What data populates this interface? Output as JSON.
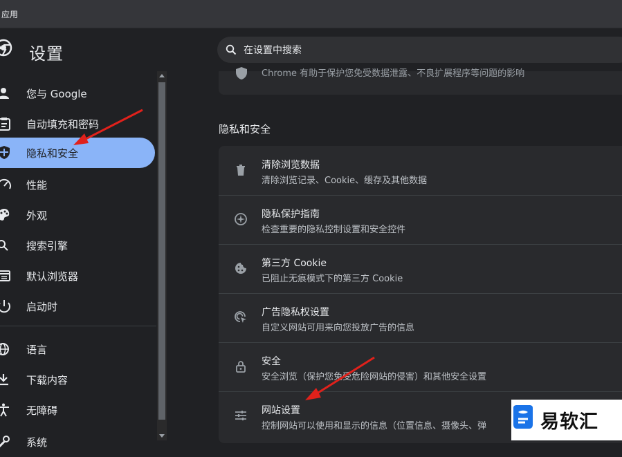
{
  "window": {
    "app_label": "应用"
  },
  "header": {
    "title": "设置",
    "search_placeholder": "在设置中搜索"
  },
  "sidebar": {
    "items": [
      {
        "label": "您与 Google",
        "icon": "person-icon"
      },
      {
        "label": "自动填充和密码",
        "icon": "clipboard-icon"
      },
      {
        "label": "隐私和安全",
        "icon": "shield-icon",
        "active": true
      },
      {
        "label": "性能",
        "icon": "speedometer-icon"
      },
      {
        "label": "外观",
        "icon": "palette-icon"
      },
      {
        "label": "搜索引擎",
        "icon": "search-icon"
      },
      {
        "label": "默认浏览器",
        "icon": "browser-icon"
      },
      {
        "label": "启动时",
        "icon": "power-icon"
      },
      {
        "label": "语言",
        "icon": "globe-icon"
      },
      {
        "label": "下载内容",
        "icon": "download-icon"
      },
      {
        "label": "无障碍",
        "icon": "accessibility-icon"
      },
      {
        "label": "系统",
        "icon": "wrench-icon"
      }
    ]
  },
  "main": {
    "top_card_text": "Chrome 有助于保护您免受数据泄露、不良扩展程序等问题的影响",
    "section_title": "隐私和安全",
    "rows": [
      {
        "title": "清除浏览数据",
        "subtitle": "清除浏览记录、Cookie、缓存及其他数据",
        "icon": "trash-icon"
      },
      {
        "title": "隐私保护指南",
        "subtitle": "检查重要的隐私控制设置和安全控件",
        "icon": "compass-icon"
      },
      {
        "title": "第三方 Cookie",
        "subtitle": "已阻止无痕模式下的第三方 Cookie",
        "icon": "cookie-icon"
      },
      {
        "title": "广告隐私权设置",
        "subtitle": "自定义网站可用来向您投放广告的信息",
        "icon": "ad-privacy-icon"
      },
      {
        "title": "安全",
        "subtitle": "安全浏览（保护您免受危险网站的侵害）和其他安全设置",
        "icon": "lock-icon"
      },
      {
        "title": "网站设置",
        "subtitle": "控制网站可以使用和显示的信息（位置信息、摄像头、弹",
        "icon": "sliders-icon"
      }
    ]
  },
  "watermark": {
    "text": "易软汇"
  },
  "colors": {
    "accent": "#8ab4f8",
    "background": "#202124",
    "card": "#292a2d",
    "arrow": "#e0211b"
  }
}
